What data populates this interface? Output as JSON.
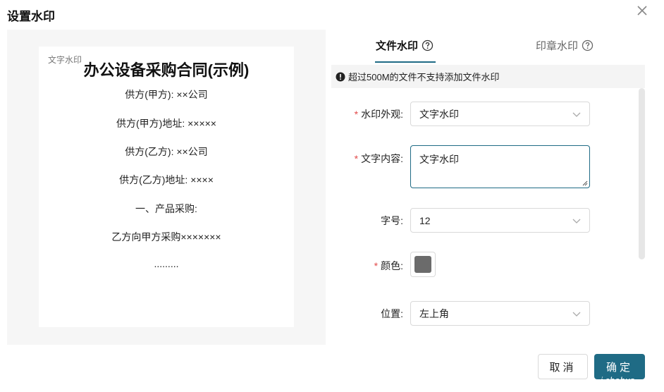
{
  "dialog": {
    "title": "设置水印"
  },
  "preview": {
    "watermark_text": "文字水印",
    "doc_title": "办公设备采购合同(示例)",
    "lines": [
      "供方(甲方): ××公司",
      "供方(甲方)地址: ×××××",
      "供方(乙方): ××公司",
      "供方(乙方)地址: ××××",
      "一、产品采购:",
      "乙方向甲方采购×××××××",
      "........."
    ]
  },
  "tabs": [
    {
      "label": "文件水印",
      "active": true
    },
    {
      "label": "印章水印",
      "active": false
    }
  ],
  "notice": {
    "text": "超过500M的文件不支持添加文件水印"
  },
  "form": {
    "appearance": {
      "label": "水印外观:",
      "value": "文字水印",
      "required": "*"
    },
    "content": {
      "label": "文字内容:",
      "value": "文字水印",
      "required": "*"
    },
    "font_size": {
      "label": "字号:",
      "value": "12"
    },
    "color": {
      "label": "颜色:",
      "value": "#6b6b6b",
      "required": "*"
    },
    "position": {
      "label": "位置:",
      "value": "左上角"
    }
  },
  "buttons": {
    "cancel": "取消",
    "ok": "确定"
  },
  "badge": "i.chobus...",
  "colors": {
    "accent": "#1f6b85",
    "required": "#e24b4b"
  }
}
